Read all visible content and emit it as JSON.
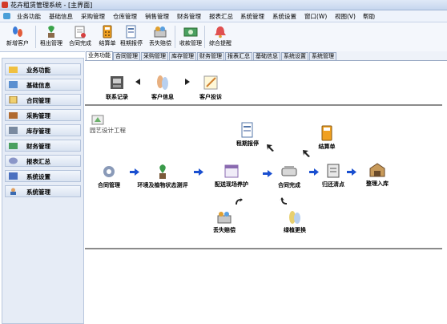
{
  "window": {
    "title": "花卉租赁管理系统 - [主界面]"
  },
  "menu": [
    "业务功能",
    "基础信息",
    "采购管理",
    "仓库管理",
    "销售管理",
    "财务管理",
    "报表汇总",
    "系统管理",
    "系统设置",
    "窗口(W)",
    "视图(V)",
    "帮助"
  ],
  "toolbar": [
    "新增客户",
    "租出管理",
    "合同完成",
    "结算单",
    "租期报停",
    "丢失赔偿",
    "收款管理",
    "综合提醒"
  ],
  "sidebar": [
    "业务功能",
    "基础信息",
    "合同管理",
    "采购管理",
    "库存管理",
    "财务管理",
    "报表汇总",
    "系统设置",
    "系统管理"
  ],
  "tabs": [
    "业务功能",
    "合同管理",
    "采购管理",
    "库存管理",
    "财务管理",
    "报表汇总",
    "基础信息",
    "系统设置",
    "系统管理"
  ],
  "flow_top": [
    "联系记录",
    "客户信息",
    "客户投诉"
  ],
  "group_title": "园艺设计工程",
  "flow_main": {
    "contract": "合同管理",
    "env": "环境及植物状态测评",
    "delivery": "配送现场养护",
    "complete": "合同完成",
    "return": "归还清点",
    "stock": "整理入库",
    "suspend": "租期报停",
    "settle": "结算单",
    "lost": "丢失赔偿",
    "replace": "绿植更换"
  }
}
